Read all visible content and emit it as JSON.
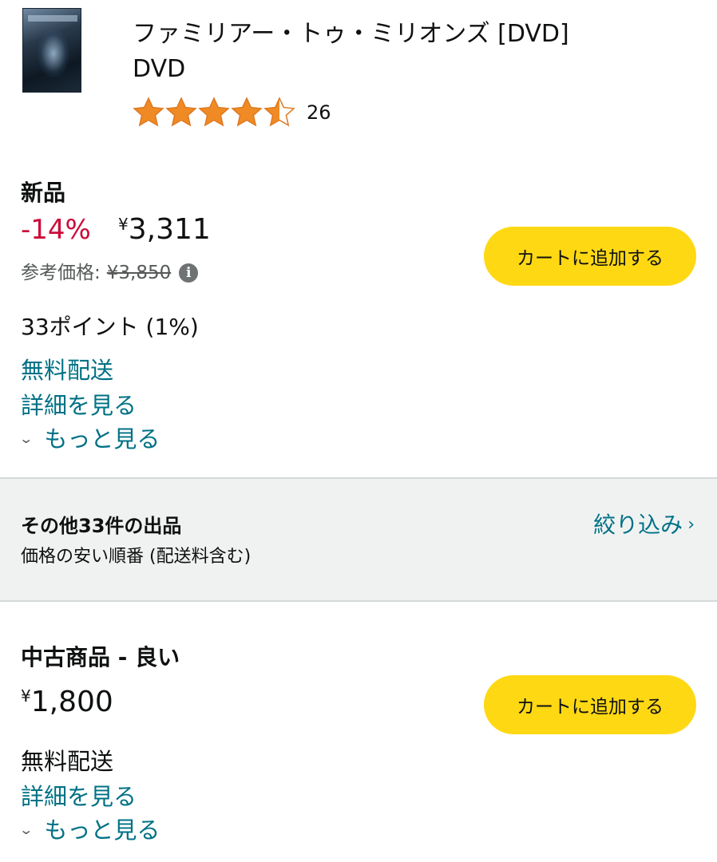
{
  "product": {
    "title": "ファミリアー・トゥ・ミリオンズ [DVD]",
    "format": "DVD",
    "rating": 4.5,
    "rating_count": "26"
  },
  "new_offer": {
    "heading": "新品",
    "discount": "-14%",
    "currency": "¥",
    "price": "3,311",
    "list_price_label": "参考価格:",
    "list_price": "¥3,850",
    "points": "33ポイント (1%)",
    "shipping": "無料配送",
    "details_link": "詳細を見る",
    "more_link": "もっと見る",
    "cart_button": "カートに追加する"
  },
  "other_offers": {
    "title": "その他33件の出品",
    "subtitle": "価格の安い順番 (配送料含む)",
    "filter_link": "絞り込み"
  },
  "used_offer": {
    "heading": "中古商品 - 良い",
    "currency": "¥",
    "price": "1,800",
    "shipping": "無料配送",
    "details_link": "詳細を見る",
    "more_link": "もっと見る",
    "cart_button": "カートに追加する"
  },
  "colors": {
    "accent_link": "#007185",
    "discount_red": "#cc0c39",
    "star": "#f08a24",
    "cart_button": "#ffd814"
  }
}
